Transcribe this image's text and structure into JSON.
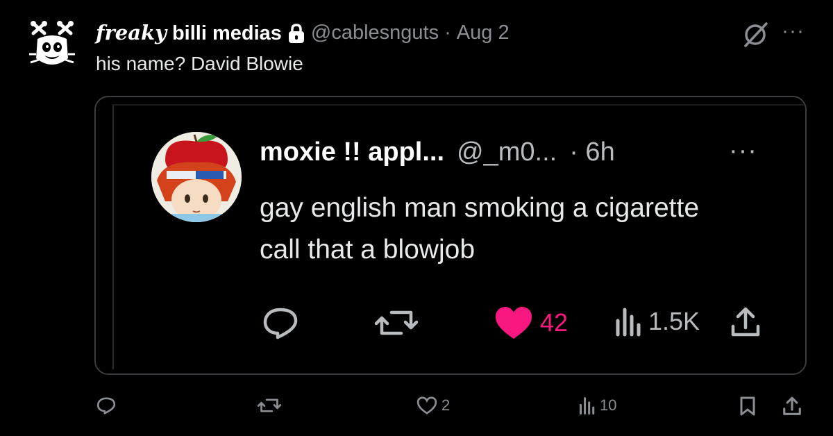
{
  "tweet": {
    "author_fancy": "freaky",
    "author_name": "billi medias",
    "lock_icon": "lock-icon",
    "handle": "@cablesnguts",
    "separator": "·",
    "date": "Aug 2",
    "text": "his name? David Blowie",
    "more_label": "···"
  },
  "quoted": {
    "author_name": "moxie !! appl...",
    "handle": "@_m0...",
    "time": "· 6h",
    "more_label": "···",
    "text": "gay english man smoking a cigarette call that a blowjob",
    "actions": {
      "reply_icon": "reply-icon",
      "retweet_icon": "retweet-icon",
      "like_icon": "heart-filled-icon",
      "like_count": "42",
      "views_icon": "views-icon",
      "views_count": "1.5K",
      "share_icon": "share-icon"
    },
    "colors": {
      "like": "#f91880"
    }
  },
  "actions": {
    "reply_icon": "reply-icon",
    "retweet_icon": "retweet-icon",
    "like_icon": "heart-outline-icon",
    "like_count": "2",
    "views_icon": "views-icon",
    "views_count": "10",
    "bookmark_icon": "bookmark-icon",
    "share_icon": "share-icon"
  },
  "colors": {
    "background": "#000000",
    "muted": "#8b8f94",
    "text": "#e7e9ea"
  }
}
